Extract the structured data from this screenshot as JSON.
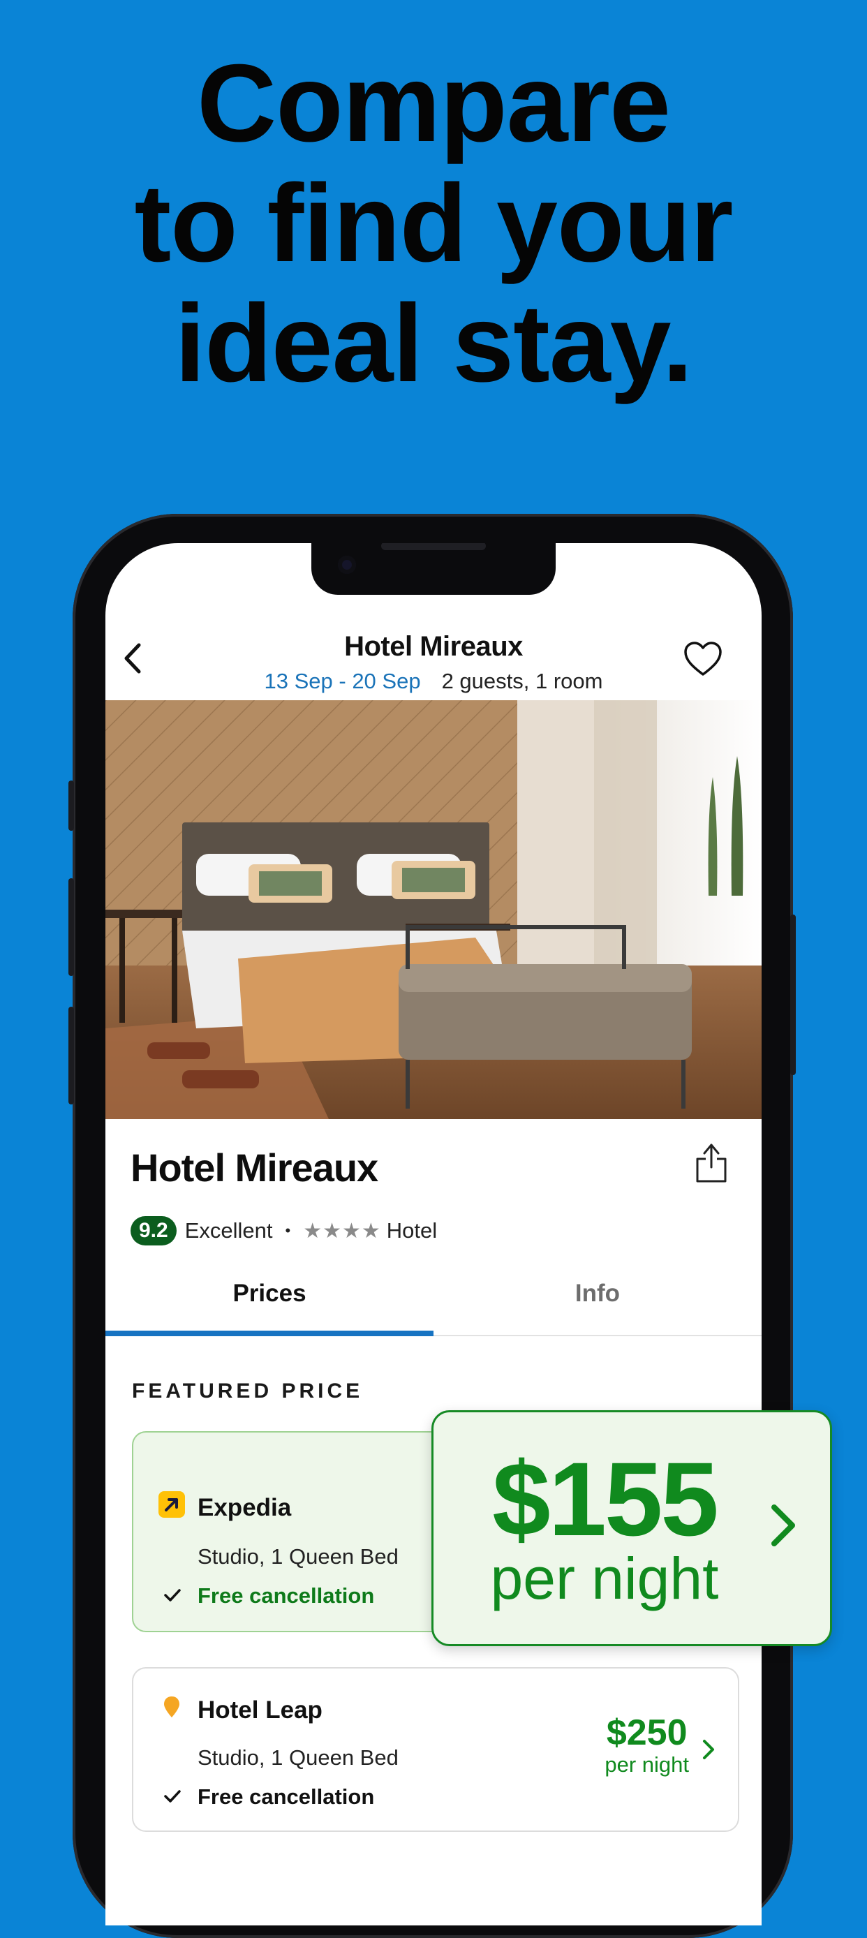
{
  "headline": {
    "line1": "Compare",
    "line2": "to find your",
    "line3": "ideal stay."
  },
  "header": {
    "title": "Hotel Mireaux",
    "dates": "13 Sep - 20 Sep",
    "guests": "2 guests, 1 room"
  },
  "hotel": {
    "name": "Hotel Mireaux",
    "score": "9.2",
    "rating_label": "Excellent",
    "stars": "★★★★",
    "type": "Hotel"
  },
  "tabs": [
    {
      "label": "Prices",
      "active": true
    },
    {
      "label": "Info",
      "active": false
    }
  ],
  "section_label": "FEATURED PRICE",
  "offers": [
    {
      "provider": "Expedia",
      "room": "Studio, 1 Queen Bed",
      "cancellation": "Free cancellation",
      "price": "$155",
      "per_night": "per night"
    },
    {
      "provider": "Hotel Leap",
      "room": "Studio, 1 Queen Bed",
      "cancellation": "Free cancellation",
      "price": "$250",
      "per_night": "per night"
    }
  ],
  "colors": {
    "background": "#0a84d6",
    "accent_blue": "#1773c2",
    "price_green": "#108a1e",
    "score_green": "#0b5d1e",
    "expedia_yellow": "#ffc107",
    "hotel_leap_orange": "#f5a623"
  },
  "icons": [
    "back-chevron-icon",
    "heart-icon",
    "share-icon",
    "expedia-logo-icon",
    "location-pin-icon",
    "checkmark-icon",
    "chevron-right-icon"
  ]
}
